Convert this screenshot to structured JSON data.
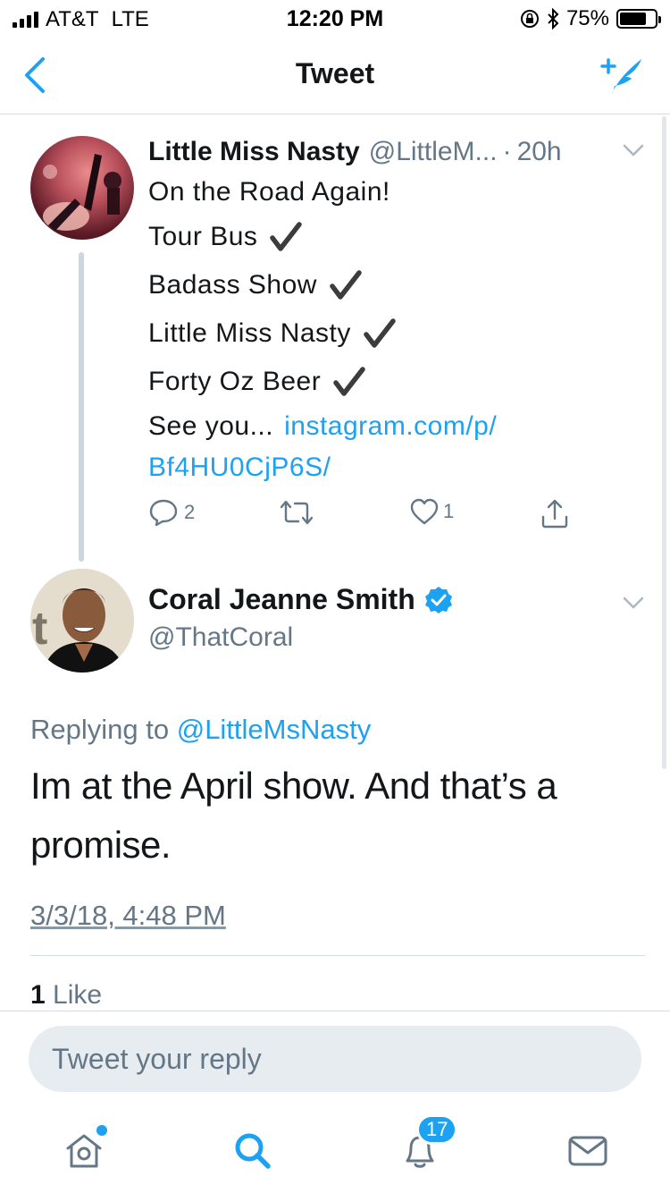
{
  "status_bar": {
    "carrier": "AT&T",
    "network": "LTE",
    "time": "12:20 PM",
    "battery_percent": "75%",
    "battery_level": 0.75
  },
  "nav": {
    "title": "Tweet",
    "back_icon": "chevron-left-icon",
    "compose_icon": "compose-tweet-icon"
  },
  "tweet1": {
    "name": "Little Miss Nasty",
    "handle": "@LittleM...",
    "separator": "·",
    "time": "20h",
    "lines": [
      {
        "text": "On the Road Again!",
        "check": false
      },
      {
        "text": "Tour Bus",
        "check": true
      },
      {
        "text": "Badass Show",
        "check": true
      },
      {
        "text": "Little Miss Nasty",
        "check": true
      },
      {
        "text": "Forty Oz Beer",
        "check": true
      }
    ],
    "see_you": "See you...",
    "link_part1": "instagram.com/p/",
    "link_part2": "Bf4HU0CjP6S/",
    "reply_count": "2",
    "retweet_count": "",
    "like_count": "1"
  },
  "tweet2": {
    "name": "Coral Jeanne Smith",
    "handle": "@ThatCoral",
    "replying_prefix": "Replying to",
    "replying_to": "@LittleMsNasty",
    "text": "Im at the April show. And that’s a promise.",
    "date": "3/3/18, 4:48 PM",
    "likes_count": "1",
    "likes_label": "Like"
  },
  "reply": {
    "placeholder": "Tweet your reply"
  },
  "tab_bar": {
    "notifications_badge": "17",
    "accent": "#1da1f2"
  },
  "colors": {
    "accent": "#1da1f2",
    "secondary_text": "#657786",
    "primary_text": "#14171a"
  }
}
